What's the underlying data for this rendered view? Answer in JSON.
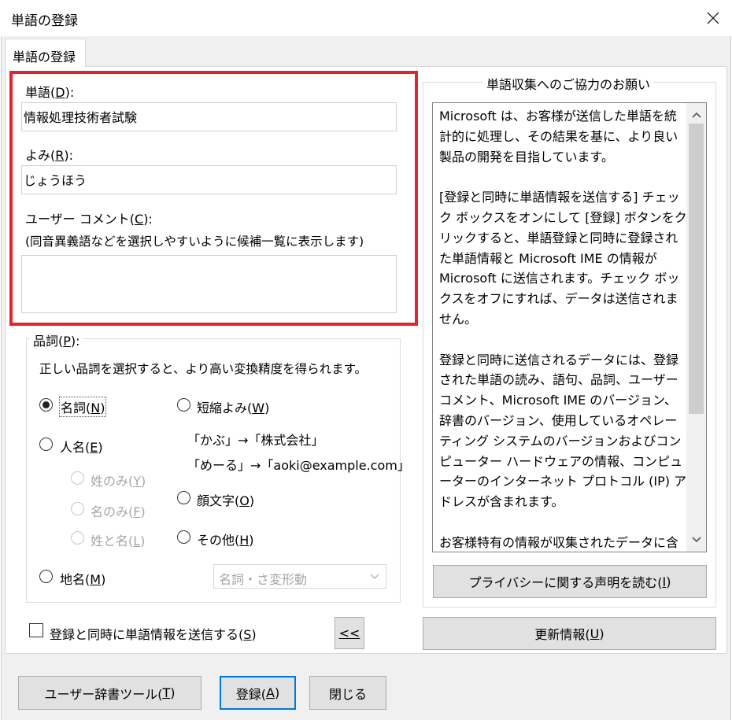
{
  "window": {
    "title": "単語の登録"
  },
  "tab": {
    "label": "単語の登録"
  },
  "word": {
    "label": "単語(",
    "mnemonic": "D",
    "suffix": "):",
    "value": "情報処理技術者試験"
  },
  "reading": {
    "label": "よみ(",
    "mnemonic": "R",
    "suffix": "):",
    "value": "じょうほう"
  },
  "comment": {
    "label": "ユーザー コメント(",
    "mnemonic": "C",
    "suffix": "):",
    "hint": "(同音異義語などを選択しやすいように候補一覧に表示します)",
    "value": ""
  },
  "pos": {
    "group_label": "品詞(",
    "group_mnemonic": "P",
    "group_suffix": "):",
    "desc": "正しい品詞を選択すると、より高い変換精度を得られます。",
    "noun": {
      "label": "名詞(",
      "mnemonic": "N",
      "suffix": ")"
    },
    "person": {
      "label": "人名(",
      "mnemonic": "E",
      "suffix": ")"
    },
    "surname": {
      "label": "姓のみ(",
      "mnemonic": "Y",
      "suffix": ")"
    },
    "given": {
      "label": "名のみ(",
      "mnemonic": "F",
      "suffix": ")"
    },
    "fullname": {
      "label": "姓と名(",
      "mnemonic": "L",
      "suffix": ")"
    },
    "place": {
      "label": "地名(",
      "mnemonic": "M",
      "suffix": ")"
    },
    "abbrev": {
      "label": "短縮よみ(",
      "mnemonic": "W",
      "suffix": ")"
    },
    "example1": "「かぶ」→「株式会社」",
    "example2": "「めーる」→「aoki@example.com」",
    "emoticon": {
      "label": "顔文字(",
      "mnemonic": "O",
      "suffix": ")"
    },
    "other": {
      "label": "その他(",
      "mnemonic": "H",
      "suffix": ")"
    },
    "subtype_value": "名詞・さ変形動"
  },
  "send_checkbox": {
    "label": "登録と同時に単語情報を送信する(",
    "mnemonic": "S",
    "suffix": ")"
  },
  "collapse_button": {
    "label": "<<"
  },
  "info": {
    "group_label": "単語収集へのご協力のお願い",
    "p1": "Microsoft は、お客様が送信した単語を統計的に処理し、その結果を基に、より良い製品の開発を目指しています。",
    "p2": "[登録と同時に単語情報を送信する] チェック ボックスをオンにして [登録] ボタンをクリックすると、単語登録と同時に登録された単語情報と Microsoft IME の情報が Microsoft に送信されます。チェック ボックスをオフにすれば、データは送信されません。",
    "p3": "登録と同時に送信されるデータには、登録された単語の読み、語句、品詞、ユーザー コメント、Microsoft IME のバージョン、辞書のバージョン、使用しているオペレーティング システムのバージョンおよびコンピューター ハードウェアの情報、コンピューターのインターネット プロトコル (IP) アドレスが含まれます。",
    "p4": "お客様特有の情報が収集されたデータに含まれることがあります。このような情報が存在する場合でも、Microsoft では、お客様を特定するために使用することはありません。"
  },
  "privacy_button": {
    "label": "プライバシーに関する声明を読む(",
    "mnemonic": "I",
    "suffix": ")"
  },
  "update_button": {
    "label": "更新情報(",
    "mnemonic": "U",
    "suffix": ")"
  },
  "dict_tool_button": {
    "label": "ユーザー辞書ツール(",
    "mnemonic": "T",
    "suffix": ")"
  },
  "register_button": {
    "label": "登録(",
    "mnemonic": "A",
    "suffix": ")"
  },
  "close_button": {
    "label": "閉じる"
  },
  "colors": {
    "highlight": "#e3242b",
    "focus": "#0078d7",
    "button_face": "#e1e1e1"
  }
}
